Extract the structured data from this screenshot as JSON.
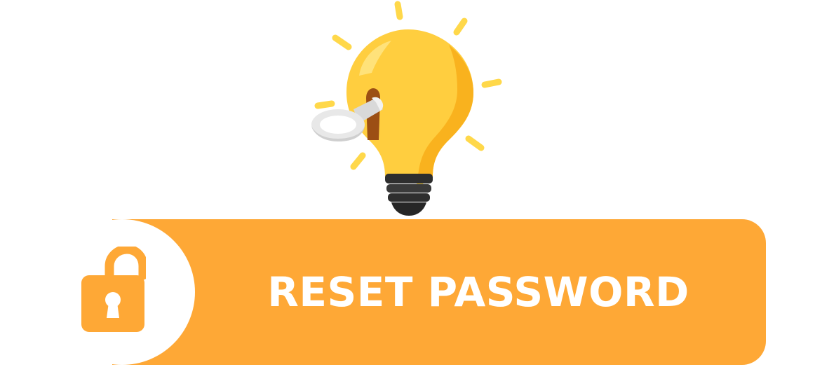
{
  "banner": {
    "label": "RESET PASSWORD",
    "color": "#FEA836",
    "text_color": "#FFFFFF"
  },
  "icons": {
    "illustration": "lightbulb-with-key-icon",
    "badge": "unlocked-padlock-icon"
  },
  "colors": {
    "bulb": "#FFCE3F",
    "bulb_shade": "#F9B21E",
    "ray": "#FFD84A",
    "socket": "#2E2E2E",
    "key": "#E8E8E8"
  }
}
